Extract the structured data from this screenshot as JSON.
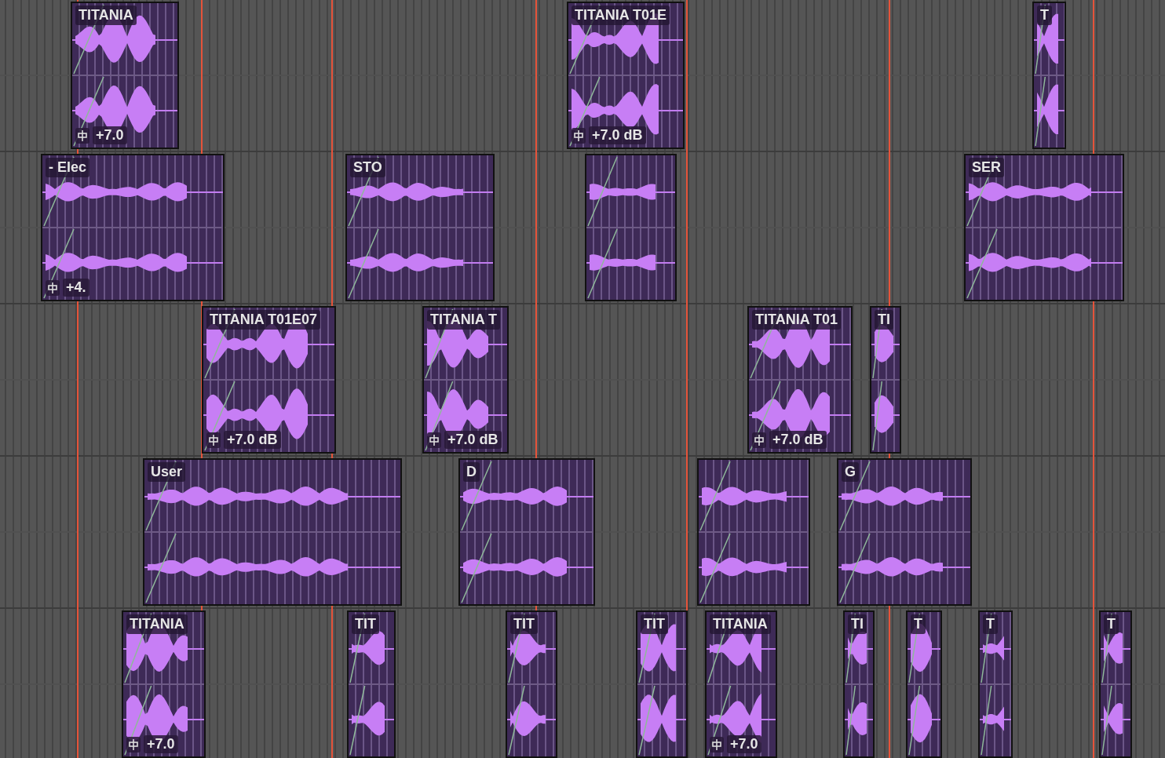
{
  "tracks": [
    {
      "clips": [
        {
          "kind": "audio",
          "name": "TITANIA",
          "gain": "+7.0"
        },
        {
          "kind": "audio",
          "name": "TITANIA T01E",
          "gain": "+7.0 dB"
        },
        {
          "kind": "audio",
          "name": "T"
        }
      ]
    },
    {
      "clips": [
        {
          "kind": "audio",
          "name": "- Elec",
          "gain": "+4."
        },
        {
          "kind": "audio",
          "name": "STO"
        },
        {
          "kind": "audio"
        },
        {
          "kind": "audio",
          "name": "SER"
        }
      ]
    },
    {
      "clips": [
        {
          "kind": "audio",
          "name": "TITANIA T01E07",
          "gain": "+7.0 dB"
        },
        {
          "kind": "audio",
          "name": "TITANIA T",
          "gain": "+7.0 dB"
        },
        {
          "kind": "audio",
          "name": "TITANIA T01",
          "gain": "+7.0 dB"
        },
        {
          "kind": "audio",
          "name": "TI"
        }
      ]
    },
    {
      "clips": [
        {
          "kind": "audio",
          "name": "User"
        },
        {
          "kind": "audio",
          "name": "D"
        },
        {
          "kind": "audio"
        },
        {
          "kind": "audio",
          "name": "G"
        }
      ]
    },
    {
      "clips": [
        {
          "kind": "audio",
          "name": "TITANIA",
          "gain": "+7.0"
        },
        {
          "kind": "audio",
          "name": "TIT"
        },
        {
          "kind": "audio",
          "name": "TIT"
        },
        {
          "kind": "audio",
          "name": "TIT"
        },
        {
          "kind": "audio",
          "name": "TITANIA",
          "gain": "+7.0"
        },
        {
          "kind": "audio",
          "name": "TI"
        },
        {
          "kind": "audio",
          "name": "T"
        },
        {
          "kind": "audio",
          "name": "T"
        },
        {
          "kind": "audio",
          "name": "T"
        }
      ]
    }
  ]
}
